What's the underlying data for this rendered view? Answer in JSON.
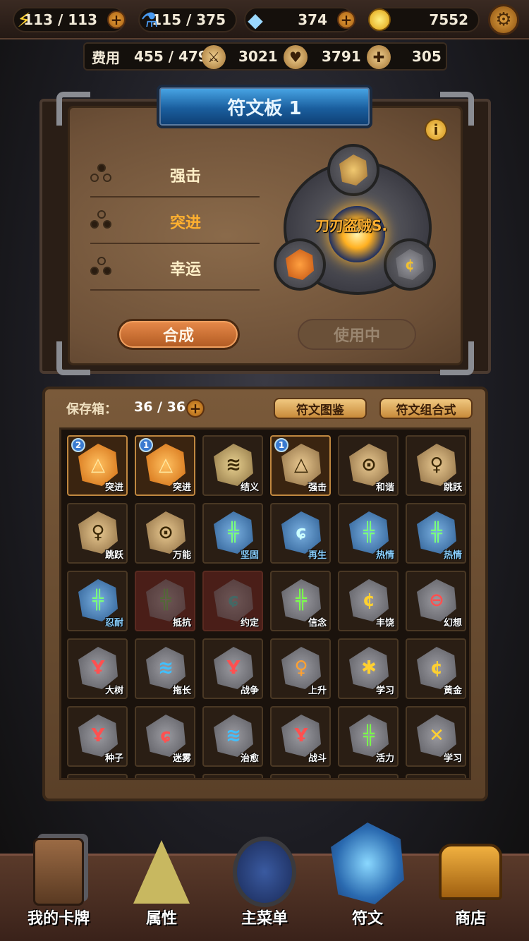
{
  "topbar": {
    "energy": "113 / 113",
    "potion": "115 / 375",
    "gems": "374",
    "gold": "7552"
  },
  "stats": {
    "cost_label": "费用",
    "cost": "455 / 479",
    "attack": "3021",
    "hp": "3791",
    "heal": "305"
  },
  "board": {
    "title": "符文板 1",
    "effects": [
      "强击",
      "突进",
      "幸运"
    ],
    "set_name": "刀刃盗贼S.",
    "combine_label": "合成",
    "inuse_label": "使用中"
  },
  "storage": {
    "label": "保存箱：",
    "count": "36 / 36",
    "catalog_label": "符文图鉴",
    "combo_label": "符文组合式"
  },
  "runes": [
    {
      "name": "突进",
      "badge": "2"
    },
    {
      "name": "突进",
      "badge": "1"
    },
    {
      "name": "结义",
      "badge": ""
    },
    {
      "name": "强击",
      "badge": "1"
    },
    {
      "name": "和谐",
      "badge": ""
    },
    {
      "name": "跳跃",
      "badge": ""
    },
    {
      "name": "跳跃",
      "badge": ""
    },
    {
      "name": "万能",
      "badge": ""
    },
    {
      "name": "坚固",
      "badge": ""
    },
    {
      "name": "再生",
      "badge": ""
    },
    {
      "name": "热情",
      "badge": ""
    },
    {
      "name": "热情",
      "badge": ""
    },
    {
      "name": "忍耐",
      "badge": ""
    },
    {
      "name": "抵抗",
      "badge": ""
    },
    {
      "name": "约定",
      "badge": ""
    },
    {
      "name": "信念",
      "badge": ""
    },
    {
      "name": "丰饶",
      "badge": ""
    },
    {
      "name": "幻想",
      "badge": ""
    },
    {
      "name": "大树",
      "badge": ""
    },
    {
      "name": "拖长",
      "badge": ""
    },
    {
      "name": "战争",
      "badge": ""
    },
    {
      "name": "上升",
      "badge": ""
    },
    {
      "name": "学习",
      "badge": ""
    },
    {
      "name": "黄金",
      "badge": ""
    },
    {
      "name": "种子",
      "badge": ""
    },
    {
      "name": "迷雾",
      "badge": ""
    },
    {
      "name": "治愈",
      "badge": ""
    },
    {
      "name": "战斗",
      "badge": ""
    },
    {
      "name": "活力",
      "badge": ""
    },
    {
      "name": "学习",
      "badge": ""
    }
  ],
  "nav": [
    "我的卡牌",
    "属性",
    "主菜单",
    "符文",
    "商店"
  ],
  "colors": {
    "accent_orange": "#ffb030",
    "title_blue": "#1a5e9e"
  }
}
